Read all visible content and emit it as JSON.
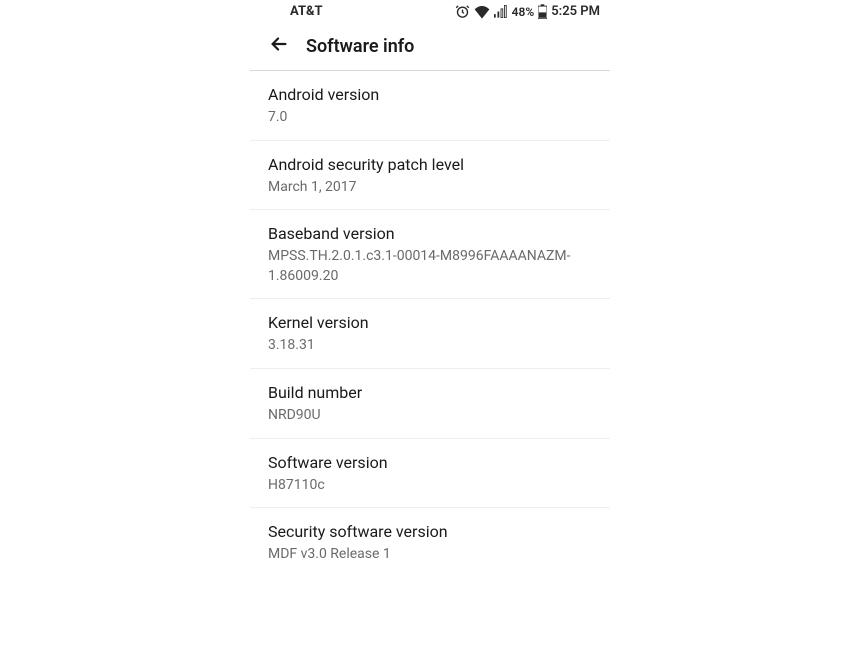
{
  "statusBar": {
    "carrier": "AT&T",
    "battery": "48%",
    "time": "5:25 PM"
  },
  "header": {
    "title": "Software info"
  },
  "items": [
    {
      "label": "Android version",
      "value": "7.0"
    },
    {
      "label": "Android security patch level",
      "value": "March 1, 2017"
    },
    {
      "label": "Baseband version",
      "value": "MPSS.TH.2.0.1.c3.1-00014-M8996FAAAANAZM-1.86009.20"
    },
    {
      "label": "Kernel version",
      "value": "3.18.31"
    },
    {
      "label": "Build number",
      "value": "NRD90U"
    },
    {
      "label": "Software version",
      "value": "H87110c"
    },
    {
      "label": "Security software version",
      "value": "MDF v3.0 Release 1"
    }
  ]
}
